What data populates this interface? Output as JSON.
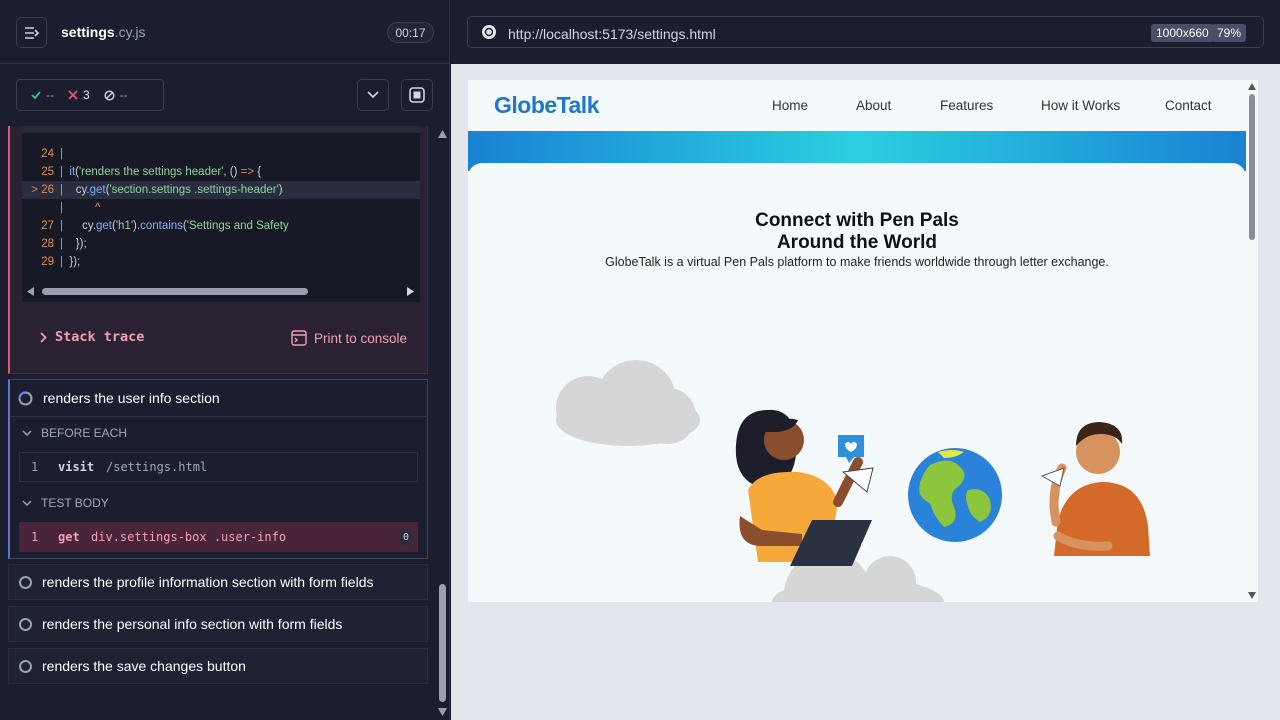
{
  "runner": {
    "spec_name": "settings",
    "spec_ext": ".cy.js",
    "timer": "00:17",
    "stats": {
      "passed": "--",
      "failed": "3",
      "pending": "--"
    }
  },
  "code_frame": {
    "lines": [
      {
        "num": "24",
        "text": ""
      },
      {
        "num": "25",
        "text": "it('renders the settings header', () => {"
      },
      {
        "num": "26",
        "text": "cy.get('section.settings .settings-header')"
      },
      {
        "num": "",
        "text": "^"
      },
      {
        "num": "27",
        "text": "cy.get('h1').contains('Settings and Safety"
      },
      {
        "num": "28",
        "text": "});"
      },
      {
        "num": "29",
        "text": "});"
      }
    ],
    "stack_trace_label": "Stack trace",
    "print_console_label": "Print to console"
  },
  "active_test": {
    "title": "renders the user info section",
    "before_each_label": "BEFORE EACH",
    "test_body_label": "TEST BODY",
    "before_each_cmds": [
      {
        "num": "1",
        "name": "visit",
        "arg": "/settings.html"
      }
    ],
    "test_body_cmds": [
      {
        "num": "1",
        "name": "get",
        "arg": "div.settings-box .user-info",
        "badge": "0"
      }
    ]
  },
  "tests": [
    {
      "title": "renders the profile information section with form fields"
    },
    {
      "title": "renders the personal info section with form fields"
    },
    {
      "title": "renders the save changes button"
    }
  ],
  "browser": {
    "url": "http://localhost:5173/settings.html",
    "viewport": "1000x660",
    "zoom": "79%"
  },
  "site": {
    "logo": "GlobeTalk",
    "nav": [
      "Home",
      "About",
      "Features",
      "How it Works",
      "Contact"
    ],
    "hero_title_1": "Connect with Pen Pals",
    "hero_title_2": "Around the World",
    "hero_subtitle": "GlobeTalk is a virtual Pen Pals platform to make friends worldwide through letter exchange."
  },
  "colors": {
    "accent": "#6272d4",
    "fail": "#e45770",
    "brand": "#2078c8"
  }
}
